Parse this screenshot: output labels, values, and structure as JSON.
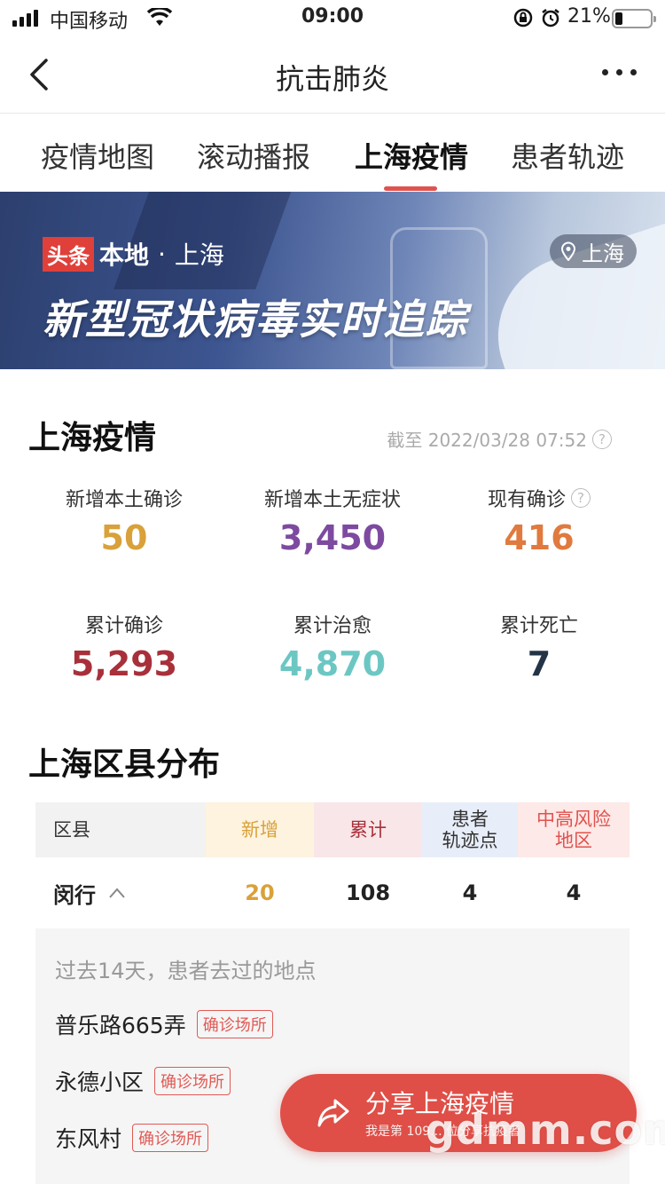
{
  "status_bar": {
    "carrier": "中国移动",
    "time": "09:00",
    "battery_pct": "21%",
    "battery_level": 0.21
  },
  "nav": {
    "title": "抗击肺炎"
  },
  "tabs": [
    {
      "label": "疫情地图"
    },
    {
      "label": "滚动播报"
    },
    {
      "label": "上海疫情",
      "active": true
    },
    {
      "label": "患者轨迹"
    }
  ],
  "banner": {
    "badge": "头条",
    "local": "本地",
    "dot": "·",
    "city": "上海",
    "headline": "新型冠状病毒实时追踪",
    "location_button": "上海"
  },
  "summary": {
    "title": "上海疫情",
    "as_of": "截至 2022/03/28 07:52",
    "stats": [
      {
        "label": "新增本土确诊",
        "value": "50",
        "color": "#d9a13a"
      },
      {
        "label": "新增本土无症状",
        "value": "3,450",
        "color": "#7d4aa0"
      },
      {
        "label": "现有确诊",
        "value": "416",
        "color": "#e07a3e",
        "help": true
      },
      {
        "label": "累计确诊",
        "value": "5,293",
        "color": "#a8303a"
      },
      {
        "label": "累计治愈",
        "value": "4,870",
        "color": "#6cc7c3"
      },
      {
        "label": "累计死亡",
        "value": "7",
        "color": "#243447"
      }
    ]
  },
  "districts": {
    "title": "上海区县分布",
    "headers": {
      "district": "区县",
      "new": "新增",
      "total": "累计",
      "track_line1": "患者",
      "track_line2": "轨迹点",
      "risk_line1": "中高风险",
      "risk_line2": "地区"
    },
    "header_colors": {
      "new_bg": "#fdf3df",
      "new_fg": "#d9a13a",
      "total_bg": "#f8e6e8",
      "total_fg": "#a8303a",
      "track_bg": "#e8eef9",
      "track_fg": "#333333",
      "risk_bg": "#fde9e7",
      "risk_fg": "#e0524e"
    },
    "row": {
      "name": "闵行",
      "new": "20",
      "total": "108",
      "track": "4",
      "risk": "4"
    },
    "detail": {
      "hint": "过去14天，患者去过的地点",
      "places": [
        {
          "name": "普乐路665弄",
          "tag": "确诊场所"
        },
        {
          "name": "永德小区",
          "tag": "确诊场所"
        },
        {
          "name": "东风村",
          "tag": "确诊场所"
        }
      ]
    }
  },
  "share": {
    "label": "分享上海疫情",
    "sub": "我是第 109... 位分享抗疫者"
  },
  "watermark": "gdmm.com",
  "colors": {
    "accent": "#e0524e"
  }
}
